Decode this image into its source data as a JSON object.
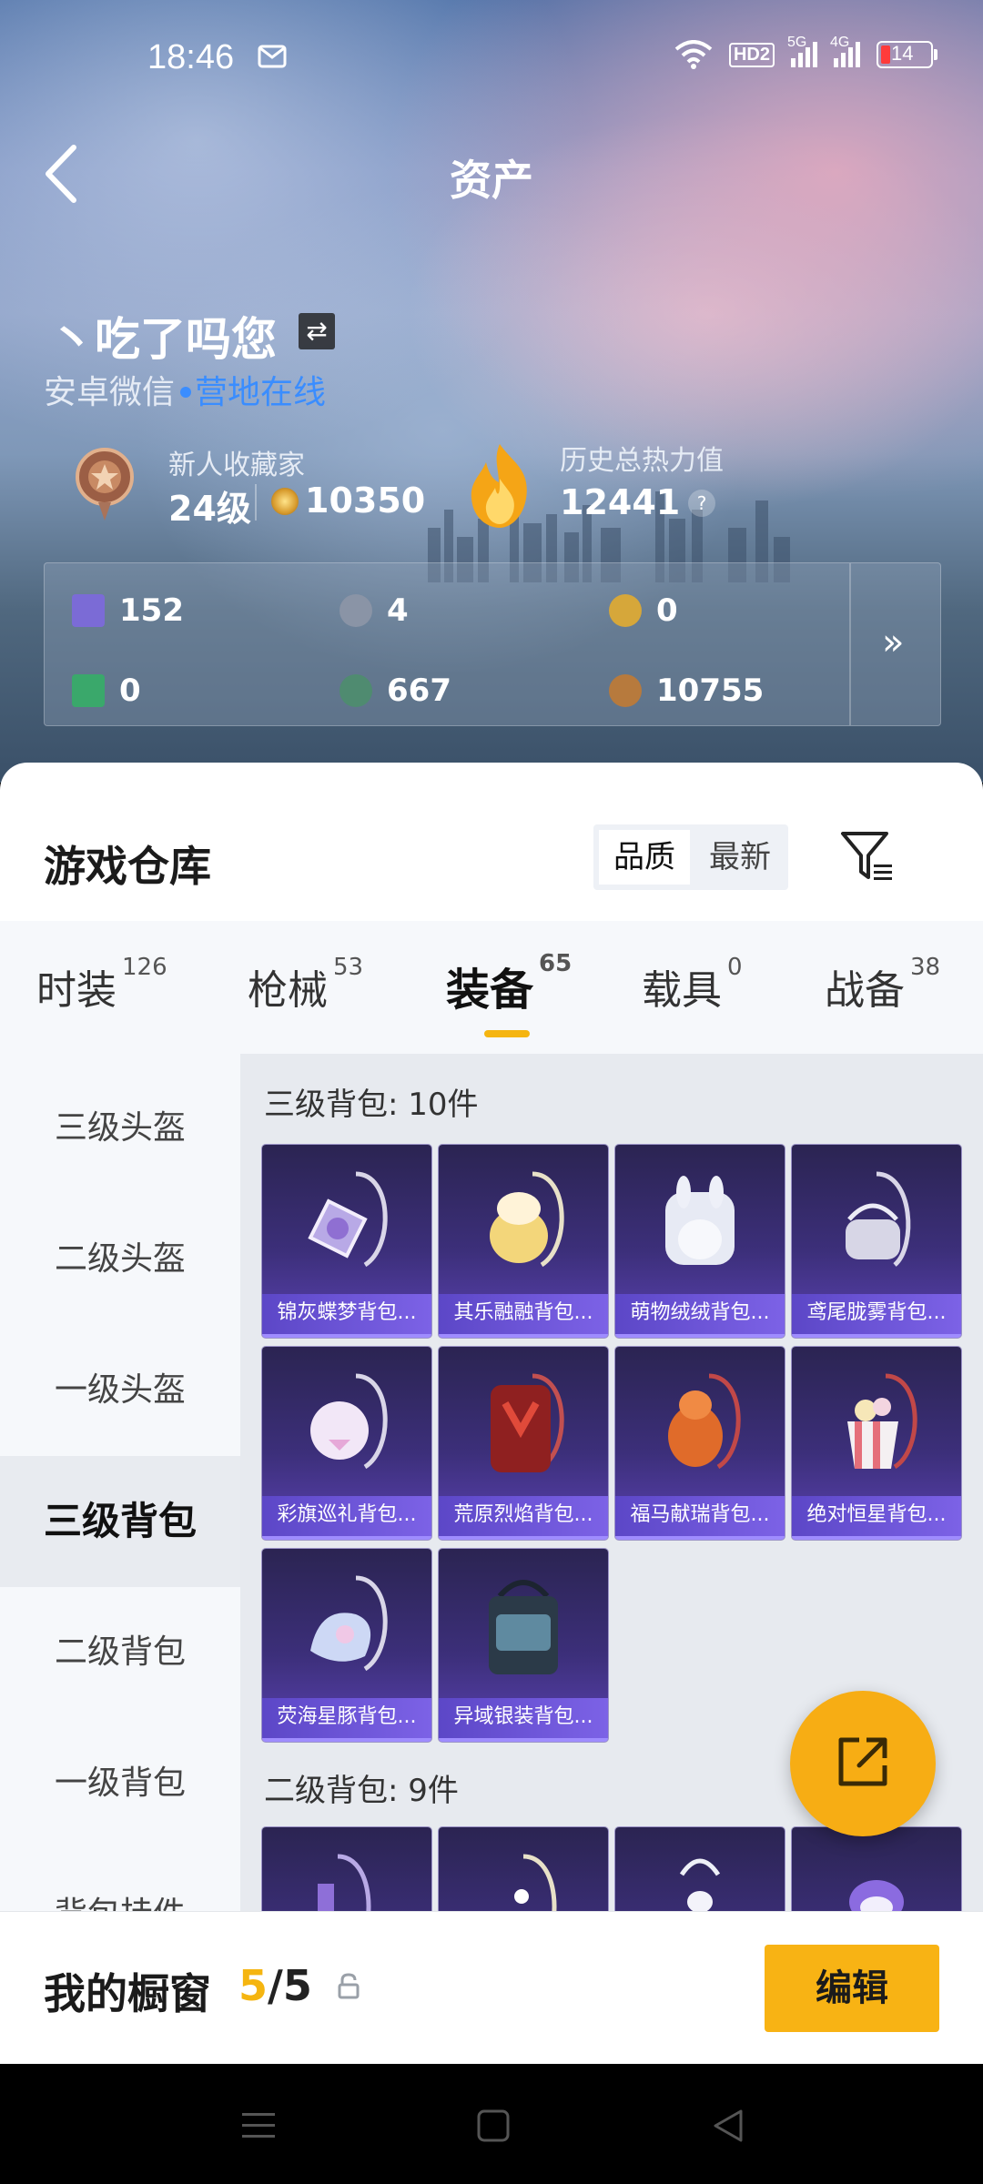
{
  "status_bar": {
    "time": "18:46",
    "hd_label": "HD2",
    "net1": "5G",
    "net2": "4G",
    "battery": "14"
  },
  "header": {
    "title": "资产"
  },
  "profile": {
    "name": "丶吃了吗您",
    "platform": "安卓微信",
    "online_text": "营地在线",
    "collector_title": "新人收藏家",
    "level": "24级",
    "coins": "10350",
    "heat_title": "历史总热力值",
    "heat_value": "12441"
  },
  "currencies": [
    {
      "icon": "purple-card-icon",
      "value": "152",
      "color": "#7b6bd6"
    },
    {
      "icon": "silver-coin-icon",
      "value": "4",
      "color": "#8a94a6"
    },
    {
      "icon": "gold-token-icon",
      "value": "0",
      "color": "#d6a73a"
    },
    {
      "icon": "green-card-icon",
      "value": "0",
      "color": "#3aa86b"
    },
    {
      "icon": "green-orb-icon",
      "value": "667",
      "color": "#4f8b70"
    },
    {
      "icon": "bronze-coin-icon",
      "value": "10755",
      "color": "#b77a3d"
    }
  ],
  "more_label": "»",
  "warehouse": {
    "title": "游戏仓库",
    "sort_options": [
      "品质",
      "最新"
    ],
    "sort_selected": "品质"
  },
  "tabs": [
    {
      "label": "时装",
      "count": "126"
    },
    {
      "label": "枪械",
      "count": "53"
    },
    {
      "label": "装备",
      "count": "65"
    },
    {
      "label": "载具",
      "count": "0"
    },
    {
      "label": "战备",
      "count": "38"
    }
  ],
  "active_tab": "装备",
  "sidebar": [
    "三级头盔",
    "二级头盔",
    "一级头盔",
    "三级背包",
    "二级背包",
    "一级背包",
    "背包挂件"
  ],
  "sidebar_active": "三级背包",
  "sections": [
    {
      "title": "三级背包: 10件",
      "items": [
        "锦灰蝶梦背包...",
        "其乐融融背包...",
        "萌物绒绒背包...",
        "鸢尾胧雾背包...",
        "彩旗巡礼背包...",
        "荒原烈焰背包...",
        "福马献瑞背包...",
        "绝对恒星背包...",
        "荧海星豚背包...",
        "异域银装背包..."
      ]
    },
    {
      "title": "二级背包: 9件",
      "items": []
    }
  ],
  "showcase": {
    "title": "我的橱窗",
    "current": "5",
    "total": "/5",
    "edit_label": "编辑"
  },
  "colors": {
    "accent": "#f5b510",
    "card_bg": "#3c2f7a",
    "card_label": "#6a52d8"
  }
}
